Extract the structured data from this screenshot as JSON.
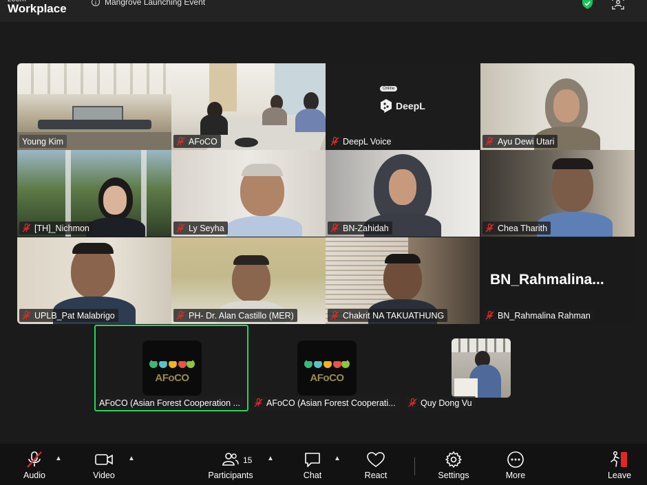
{
  "app": {
    "logo_small": "zoom",
    "logo_big": "Workplace"
  },
  "meeting": {
    "title": "Mangrove Launching Event"
  },
  "participants": [
    {
      "name": "Young Kim",
      "muted": false
    },
    {
      "name": "AFoCO",
      "muted": true
    },
    {
      "name": "DeepL Voice",
      "muted": true
    },
    {
      "name": "Ayu Dewi Utari",
      "muted": true
    },
    {
      "name": "[TH]_Nichmon",
      "muted": true
    },
    {
      "name": "Ly Seyha",
      "muted": true
    },
    {
      "name": "BN-Zahidah",
      "muted": true
    },
    {
      "name": "Chea Tharith",
      "muted": true
    },
    {
      "name": "UPLB_Pat Malabrigo",
      "muted": true
    },
    {
      "name": "PH- Dr. Alan Castillo (MER)",
      "muted": true
    },
    {
      "name": "Chakrit NA TAKUATHUNG",
      "muted": true
    },
    {
      "name": "BN_Rahmalina Rahman",
      "muted": true
    },
    {
      "name": "AFoCO (Asian Forest Cooperation ...",
      "muted": false
    },
    {
      "name": "AFoCO (Asian Forest Cooperati...",
      "muted": true
    },
    {
      "name": "Quy Dong Vu",
      "muted": true
    }
  ],
  "deepl_tile": {
    "badge": "Online",
    "brand": "DeepL"
  },
  "rahmalina_display": "BN_Rahmalina...",
  "afoco_logo_text": "AFoCO",
  "toolbar": {
    "audio": "Audio",
    "video": "Video",
    "participants": "Participants",
    "participants_count": "15",
    "chat": "Chat",
    "react": "React",
    "settings": "Settings",
    "more": "More",
    "leave": "Leave"
  },
  "colors": {
    "active_speaker": "#23d959",
    "muted_red": "#e02828",
    "leave_red": "#e02828"
  }
}
